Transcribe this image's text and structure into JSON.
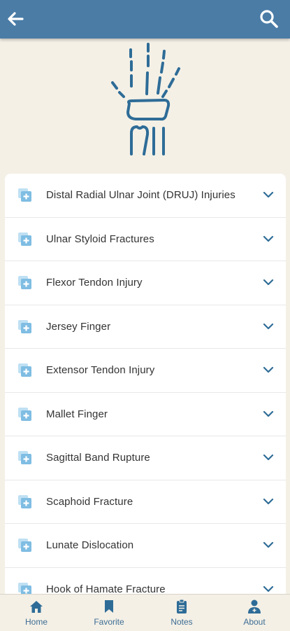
{
  "header": {
    "back_icon": "arrow-left-icon",
    "search_icon": "search-icon",
    "color": "#4a7ca6"
  },
  "logo": {
    "icon": "hand-xray-icon",
    "color": "#2e6c97"
  },
  "injuries": [
    {
      "label": "Distal Radial Ulnar Joint (DRUJ) Injuries"
    },
    {
      "label": "Ulnar Styloid Fractures"
    },
    {
      "label": "Flexor Tendon Injury"
    },
    {
      "label": "Jersey Finger"
    },
    {
      "label": "Extensor Tendon Injury"
    },
    {
      "label": "Mallet Finger"
    },
    {
      "label": "Sagittal Band Rupture"
    },
    {
      "label": "Scaphoid Fracture"
    },
    {
      "label": "Lunate Dislocation"
    },
    {
      "label": "Hook of Hamate Fracture"
    }
  ],
  "tabs": [
    {
      "label": "Home",
      "icon": "home-icon"
    },
    {
      "label": "Favorite",
      "icon": "bookmark-icon"
    },
    {
      "label": "Notes",
      "icon": "clipboard-icon"
    },
    {
      "label": "About",
      "icon": "doctor-icon"
    }
  ]
}
